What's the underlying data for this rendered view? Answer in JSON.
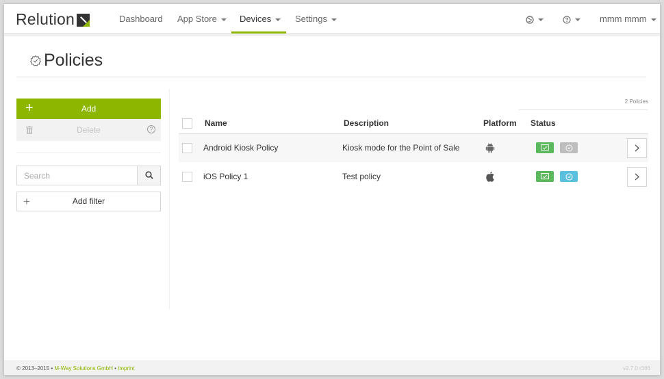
{
  "brand": {
    "name": "Relution"
  },
  "nav": {
    "items": [
      {
        "label": "Dashboard",
        "caret": false
      },
      {
        "label": "App Store",
        "caret": true
      },
      {
        "label": "Devices",
        "caret": true,
        "active": true
      },
      {
        "label": "Settings",
        "caret": true
      }
    ],
    "user": "mmm mmm"
  },
  "page": {
    "title": "Policies"
  },
  "sidebar": {
    "add_label": "Add",
    "delete_label": "Delete",
    "search_placeholder": "Search",
    "add_filter_label": "Add filter"
  },
  "table": {
    "count_label": "2 Policies",
    "headers": {
      "name": "Name",
      "description": "Description",
      "platform": "Platform",
      "status": "Status"
    },
    "rows": [
      {
        "name": "Android Kiosk Policy",
        "description": "Kiosk mode for the Point of Sale",
        "platform": "android-icon",
        "status": [
          {
            "icon": "check-icon",
            "color": "#5cb85c"
          },
          {
            "icon": "clock-icon",
            "color": "#bdbdbd"
          }
        ]
      },
      {
        "name": "iOS Policy 1",
        "description": "Test policy",
        "platform": "apple-icon",
        "status": [
          {
            "icon": "check-icon",
            "color": "#5cb85c"
          },
          {
            "icon": "clock-icon",
            "color": "#5bc0de"
          }
        ]
      }
    ]
  },
  "footer": {
    "copyright": "© 2013–2015 • ",
    "company": "M-Way Solutions GmbH",
    "separator": " • ",
    "imprint": "Imprint",
    "version": "v2.7.0 r386"
  },
  "colors": {
    "accent": "#8db600"
  }
}
